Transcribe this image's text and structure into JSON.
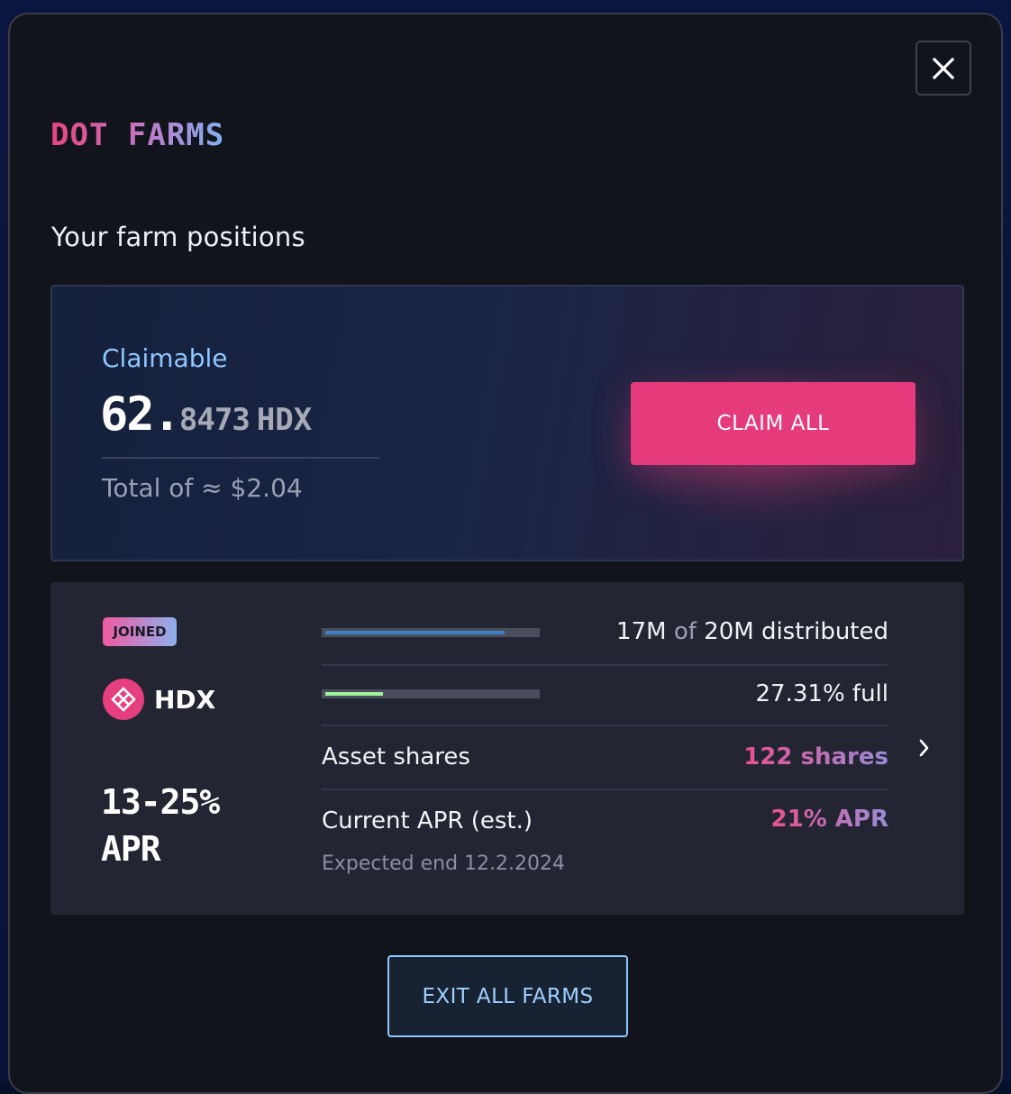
{
  "modal": {
    "brand_text": "DOT FARMS",
    "section_title": "Your farm positions",
    "close_icon": "close-icon"
  },
  "claim": {
    "label": "Claimable",
    "amount_int": "62.",
    "amount_dec": "8473",
    "unit": "HDX",
    "total": "Total of ≈ $2.04",
    "button_label": "CLAIM ALL",
    "accent_color": "#e63b7a"
  },
  "farm": {
    "badge": "JOINED",
    "asset_name": "HDX",
    "asset_icon": "hdx-logo-icon",
    "apr_range_line1": "13-25%",
    "apr_range_line2": "APR",
    "distributed": {
      "current": "17M",
      "of_word": "of",
      "total": "20M distributed",
      "progress": 0.85,
      "color": "#3f7fc4"
    },
    "fullness": {
      "text": "27.31% full",
      "progress": 0.2731,
      "color": "#9ef49a"
    },
    "asset_shares": {
      "label": "Asset shares",
      "value": "122 shares"
    },
    "current_apr": {
      "label": "Current APR (est.)",
      "value": "21% APR"
    },
    "expected_end": "Expected end 12.2.2024",
    "chevron_icon": "chevron-right-icon"
  },
  "footer": {
    "exit_label": "EXIT ALL FARMS"
  }
}
